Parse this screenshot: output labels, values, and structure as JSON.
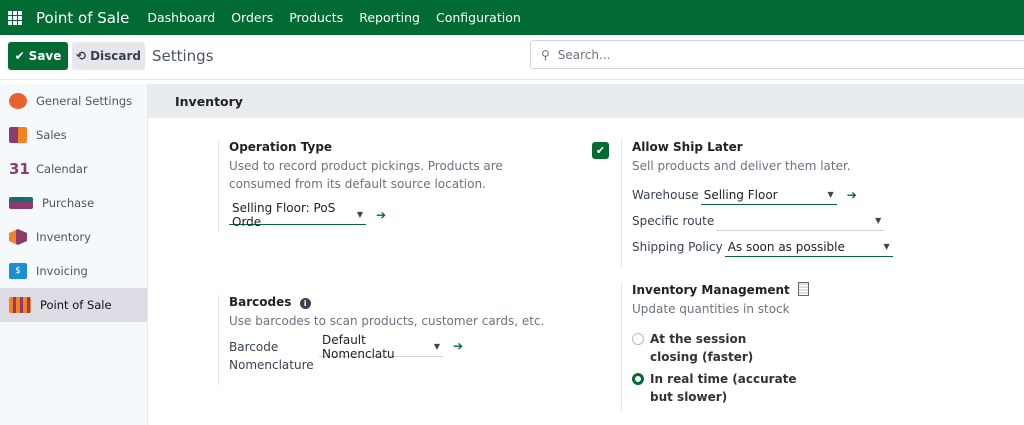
{
  "navbar": {
    "brand": "Point of Sale",
    "menu": [
      "Dashboard",
      "Orders",
      "Products",
      "Reporting",
      "Configuration"
    ]
  },
  "control_panel": {
    "save": "Save",
    "discard": "Discard",
    "title": "Settings",
    "search_placeholder": "Search..."
  },
  "sidebar": {
    "items": [
      {
        "label": "General Settings",
        "icon": "general-settings-icon",
        "color": "#e8622c"
      },
      {
        "label": "Sales",
        "icon": "sales-icon",
        "color": "#f06a3a"
      },
      {
        "label": "Calendar",
        "icon": "calendar-icon",
        "color": "#8c3b6e"
      },
      {
        "label": "Purchase",
        "icon": "purchase-icon",
        "color": "#1a6b6b"
      },
      {
        "label": "Inventory",
        "icon": "inventory-icon",
        "color": "#f58220"
      },
      {
        "label": "Invoicing",
        "icon": "invoicing-icon",
        "color": "#1a8fd6"
      },
      {
        "label": "Point of Sale",
        "icon": "pos-icon",
        "color": "#e8622c",
        "active": true
      }
    ]
  },
  "section": {
    "title": "Inventory"
  },
  "operation_type": {
    "title": "Operation Type",
    "desc": "Used to record product pickings. Products are consumed from its default source location.",
    "value": "Selling Floor: PoS Orde"
  },
  "barcodes": {
    "title": "Barcodes",
    "desc": "Use barcodes to scan products, customer cards, etc.",
    "label": "Barcode Nomenclature",
    "value": "Default Nomenclatu"
  },
  "ship_later": {
    "checked": true,
    "title": "Allow Ship Later",
    "desc": "Sell products and deliver them later.",
    "warehouse_label": "Warehouse",
    "warehouse_value": "Selling Floor",
    "route_label": "Specific route",
    "route_value": "",
    "policy_label": "Shipping Policy",
    "policy_value": "As soon as possible"
  },
  "inventory_mgmt": {
    "title": "Inventory Management",
    "desc": "Update quantities in stock",
    "options": [
      {
        "label": "At the session closing (faster)",
        "selected": false
      },
      {
        "label": "In real time (accurate but slower)",
        "selected": true
      }
    ]
  },
  "colors": {
    "brand": "#016b33"
  }
}
